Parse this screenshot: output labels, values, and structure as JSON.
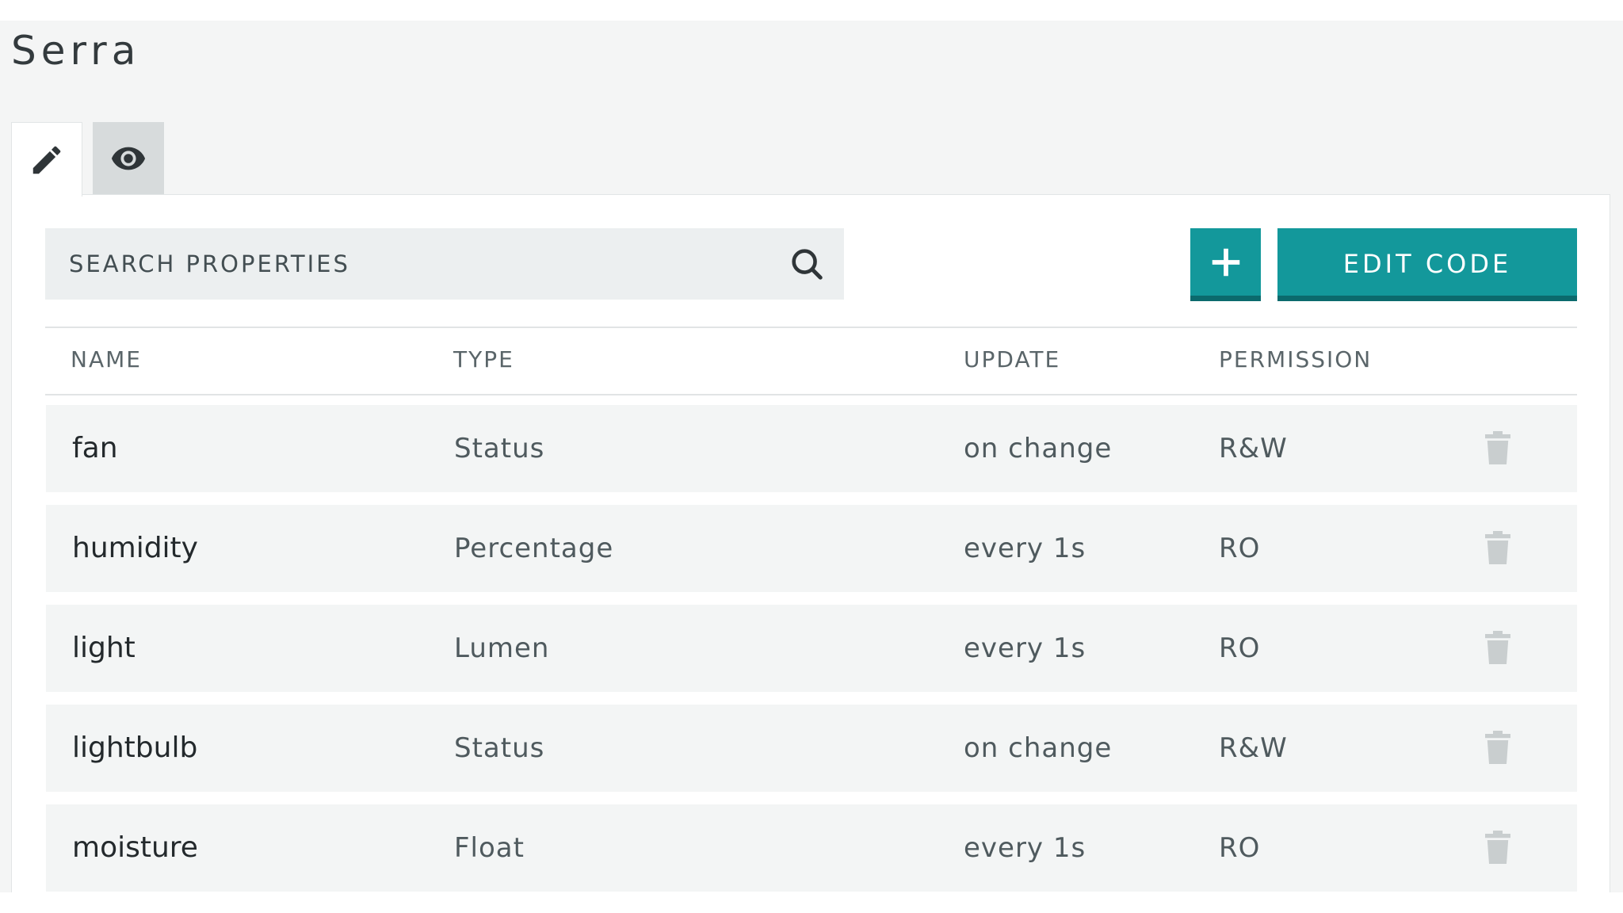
{
  "app": {
    "title": "Serra"
  },
  "tabs": [
    {
      "icon": "pencil-icon",
      "active": true
    },
    {
      "icon": "eye-icon",
      "active": false
    }
  ],
  "search": {
    "placeholder": "SEARCH PROPERTIES",
    "icon": "search-icon"
  },
  "toolbar": {
    "add_icon": "plus-icon",
    "edit_code_label": "EDIT CODE"
  },
  "table": {
    "columns": [
      "NAME",
      "TYPE",
      "UPDATE",
      "PERMISSION"
    ],
    "rows": [
      {
        "name": "fan",
        "type": "Status",
        "update": "on change",
        "permission": "R&W"
      },
      {
        "name": "humidity",
        "type": "Percentage",
        "update": "every 1s",
        "permission": "RO"
      },
      {
        "name": "light",
        "type": "Lumen",
        "update": "every 1s",
        "permission": "RO"
      },
      {
        "name": "lightbulb",
        "type": "Status",
        "update": "on change",
        "permission": "R&W"
      },
      {
        "name": "moisture",
        "type": "Float",
        "update": "every 1s",
        "permission": "RO"
      }
    ]
  },
  "colors": {
    "accent": "#13989b",
    "accent_dark": "#0b6a6d",
    "background": "#f4f5f5",
    "row_background": "#f3f5f5"
  }
}
